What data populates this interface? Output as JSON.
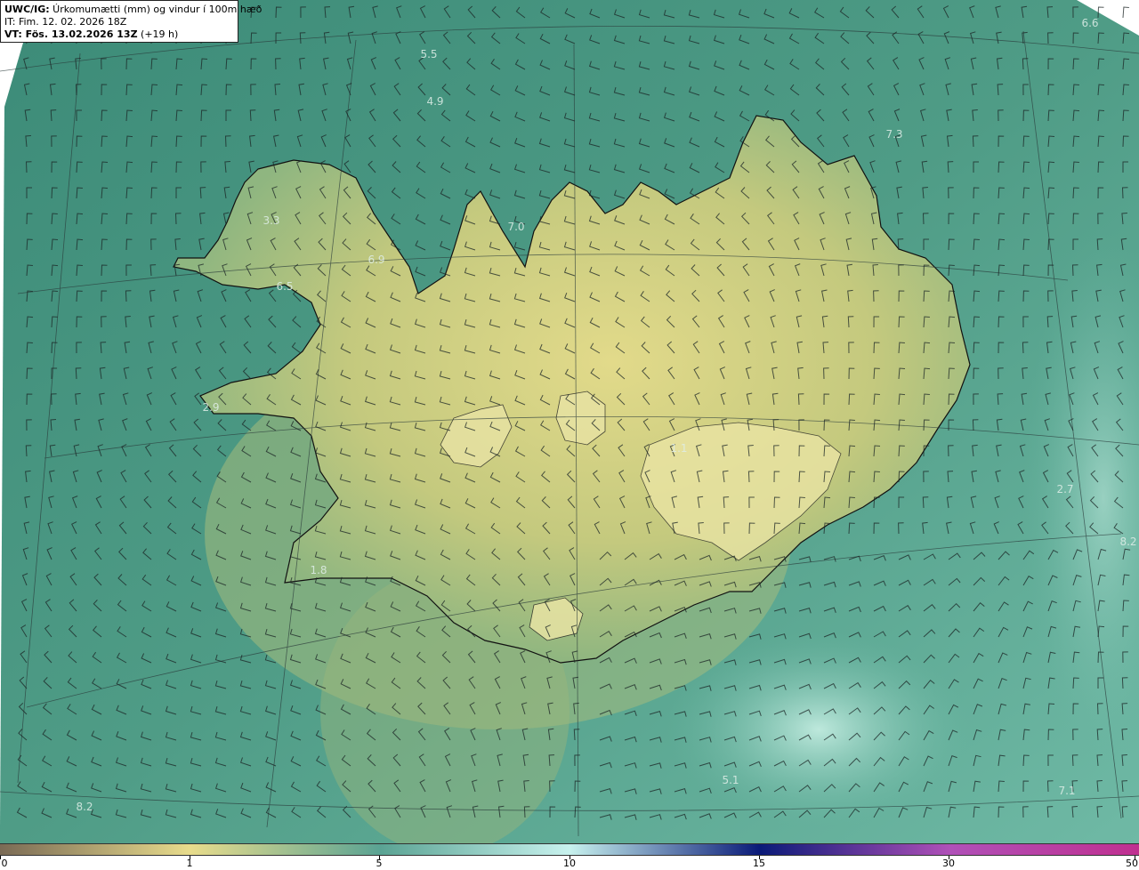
{
  "header": {
    "title_prefix": "UWC/IG:",
    "title_text": " Úrkomumætti (mm) og vindur í 100m hæð",
    "it_line": "IT: Fim. 12. 02. 2026 18Z",
    "vt_prefix": "VT:",
    "vt_bold": " Fös. 13.02.2026 13Z",
    "vt_rest": " (+19 h)"
  },
  "map_values": [
    {
      "text": "6.6"
    },
    {
      "text": "5.5"
    },
    {
      "text": "4.9"
    },
    {
      "text": "7.3"
    },
    {
      "text": "3.3"
    },
    {
      "text": "7.0"
    },
    {
      "text": "6.9"
    },
    {
      "text": "6.5"
    },
    {
      "text": "2.9"
    },
    {
      "text": "1.1"
    },
    {
      "text": "2.7"
    },
    {
      "text": "8.2"
    },
    {
      "text": "1.8"
    },
    {
      "text": "5.1"
    },
    {
      "text": "7.1"
    },
    {
      "text": "8.2"
    }
  ],
  "legend": {
    "ticks": [
      "0",
      "1",
      "5",
      "10",
      "15",
      "30",
      "50"
    ],
    "colors": [
      "#7a6a55",
      "#e8dc8c",
      "#5aa393",
      "#c8f2ee",
      "#0a1a78",
      "#b050b8",
      "#c03090"
    ]
  },
  "colors": {
    "sea": "#3f8f7c",
    "land_high": "#d8d484",
    "coast_line": "#111111"
  }
}
